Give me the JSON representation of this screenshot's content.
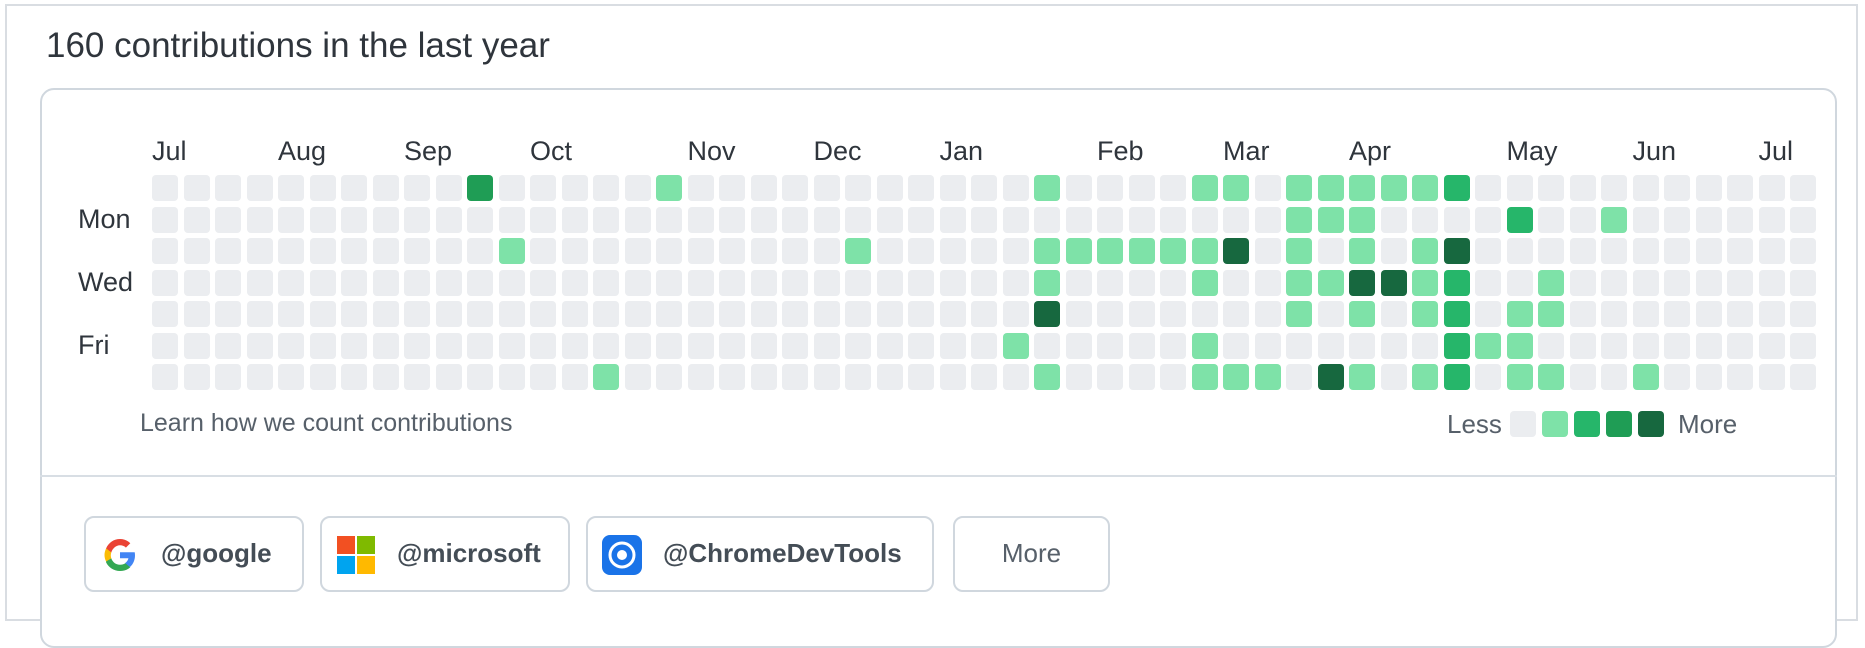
{
  "header": {
    "title": "160 contributions in the last year"
  },
  "graph": {
    "months": [
      "Jul",
      "Aug",
      "Sep",
      "Oct",
      "Nov",
      "Dec",
      "Jan",
      "Feb",
      "Mar",
      "Apr",
      "May",
      "Jun",
      "Jul"
    ],
    "month_start_weeks": [
      0,
      4,
      8,
      12,
      17,
      21,
      25,
      30,
      34,
      38,
      43,
      47,
      51
    ],
    "day_labels": [
      "Mon",
      "Wed",
      "Fri"
    ],
    "level_colors": [
      "#ebedf0",
      "#7ee2a8",
      "#26b66a",
      "#1f9d55",
      "#17683f"
    ],
    "weeks": [
      [
        0,
        0,
        0,
        0,
        0,
        0,
        0
      ],
      [
        0,
        0,
        0,
        0,
        0,
        0,
        0
      ],
      [
        0,
        0,
        0,
        0,
        0,
        0,
        0
      ],
      [
        0,
        0,
        0,
        0,
        0,
        0,
        0
      ],
      [
        0,
        0,
        0,
        0,
        0,
        0,
        0
      ],
      [
        0,
        0,
        0,
        0,
        0,
        0,
        0
      ],
      [
        0,
        0,
        0,
        0,
        0,
        0,
        0
      ],
      [
        0,
        0,
        0,
        0,
        0,
        0,
        0
      ],
      [
        0,
        0,
        0,
        0,
        0,
        0,
        0
      ],
      [
        0,
        0,
        0,
        0,
        0,
        0,
        0
      ],
      [
        3,
        0,
        0,
        0,
        0,
        0,
        0
      ],
      [
        0,
        0,
        1,
        0,
        0,
        0,
        0
      ],
      [
        0,
        0,
        0,
        0,
        0,
        0,
        0
      ],
      [
        0,
        0,
        0,
        0,
        0,
        0,
        0
      ],
      [
        0,
        0,
        0,
        0,
        0,
        0,
        1
      ],
      [
        0,
        0,
        0,
        0,
        0,
        0,
        0
      ],
      [
        1,
        0,
        0,
        0,
        0,
        0,
        0
      ],
      [
        0,
        0,
        0,
        0,
        0,
        0,
        0
      ],
      [
        0,
        0,
        0,
        0,
        0,
        0,
        0
      ],
      [
        0,
        0,
        0,
        0,
        0,
        0,
        0
      ],
      [
        0,
        0,
        0,
        0,
        0,
        0,
        0
      ],
      [
        0,
        0,
        0,
        0,
        0,
        0,
        0
      ],
      [
        0,
        0,
        1,
        0,
        0,
        0,
        0
      ],
      [
        0,
        0,
        0,
        0,
        0,
        0,
        0
      ],
      [
        0,
        0,
        0,
        0,
        0,
        0,
        0
      ],
      [
        0,
        0,
        0,
        0,
        0,
        0,
        0
      ],
      [
        0,
        0,
        0,
        0,
        0,
        0,
        0
      ],
      [
        0,
        0,
        0,
        0,
        0,
        1,
        0
      ],
      [
        1,
        0,
        1,
        1,
        4,
        0,
        1
      ],
      [
        0,
        0,
        1,
        0,
        0,
        0,
        0
      ],
      [
        0,
        0,
        1,
        0,
        0,
        0,
        0
      ],
      [
        0,
        0,
        1,
        0,
        0,
        0,
        0
      ],
      [
        0,
        0,
        1,
        0,
        0,
        0,
        0
      ],
      [
        1,
        0,
        1,
        1,
        0,
        1,
        1
      ],
      [
        1,
        0,
        4,
        0,
        0,
        0,
        1
      ],
      [
        0,
        0,
        0,
        0,
        0,
        0,
        1
      ],
      [
        1,
        1,
        1,
        1,
        1,
        0,
        0
      ],
      [
        1,
        1,
        0,
        1,
        0,
        0,
        4
      ],
      [
        1,
        1,
        1,
        4,
        1,
        0,
        1
      ],
      [
        1,
        0,
        0,
        4,
        0,
        0,
        0
      ],
      [
        1,
        0,
        1,
        1,
        1,
        0,
        1
      ],
      [
        2,
        0,
        4,
        2,
        2,
        2,
        2
      ],
      [
        0,
        0,
        0,
        0,
        0,
        1,
        0
      ],
      [
        0,
        2,
        0,
        0,
        1,
        1,
        1
      ],
      [
        0,
        0,
        0,
        1,
        1,
        0,
        1
      ],
      [
        0,
        0,
        0,
        0,
        0,
        0,
        0
      ],
      [
        0,
        1,
        0,
        0,
        0,
        0,
        0
      ],
      [
        0,
        0,
        0,
        0,
        0,
        0,
        1
      ],
      [
        0,
        0,
        0,
        0,
        0,
        0,
        0
      ],
      [
        0,
        0,
        0,
        0,
        0,
        0,
        0
      ],
      [
        0,
        0,
        0,
        0,
        0,
        0,
        0
      ],
      [
        0,
        0,
        0,
        0,
        0,
        0,
        0
      ],
      [
        0,
        0,
        0,
        0,
        0,
        0,
        0
      ]
    ],
    "learn_link": "Learn how we count contributions",
    "legend_less": "Less",
    "legend_more": "More"
  },
  "orgs": [
    {
      "name": "@google",
      "icon": "google-logo-icon"
    },
    {
      "name": "@microsoft",
      "icon": "microsoft-logo-icon"
    },
    {
      "name": "@ChromeDevTools",
      "icon": "chrome-devtools-icon"
    }
  ],
  "more_button": "More"
}
